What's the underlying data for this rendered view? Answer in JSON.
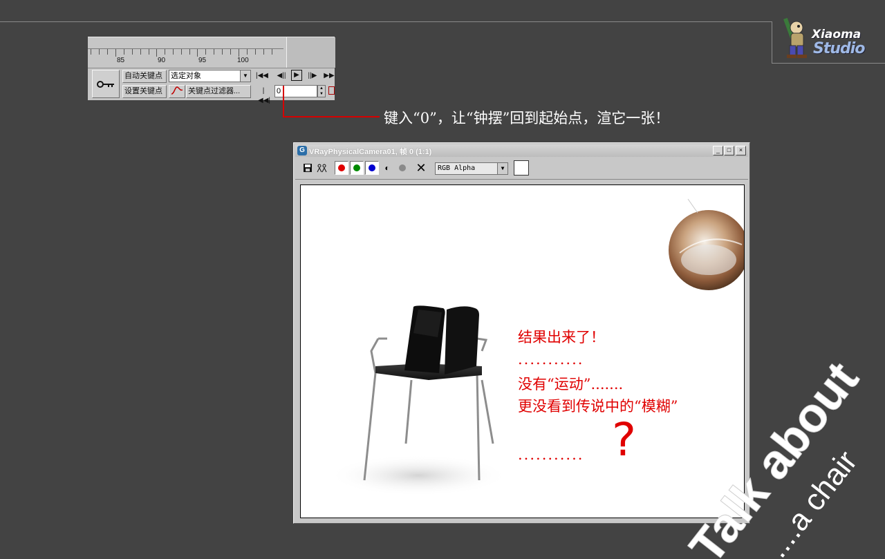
{
  "logo": {
    "line1": "Xiaoma",
    "line2": "Studio"
  },
  "timeline": {
    "ticks": [
      "85",
      "90",
      "95",
      "100"
    ],
    "auto_key_label": "自动关键点",
    "set_key_label": "设置关键点",
    "selection_value": "选定对象",
    "key_filters_label": "关键点过滤器...",
    "current_frame": "0"
  },
  "callout": {
    "text": "键入“0”，让“钟摆”回到起始点，渲它一张！"
  },
  "render_window": {
    "title": "VRayPhysicalCamera01, 帧 0 (1:1)",
    "channel_value": "RGB Alpha",
    "channel_colors": {
      "red": "#e00000",
      "green": "#008a00",
      "blue": "#0000d0"
    }
  },
  "render_notes": {
    "line1": "结果出来了！",
    "dots1": "...........",
    "line2": "没有“运动”.......",
    "line3": "更没看到传说中的“模糊”",
    "dots2": "...........",
    "question": "?"
  },
  "watermark": {
    "main": "Talk about",
    "sub": "....a chair"
  }
}
